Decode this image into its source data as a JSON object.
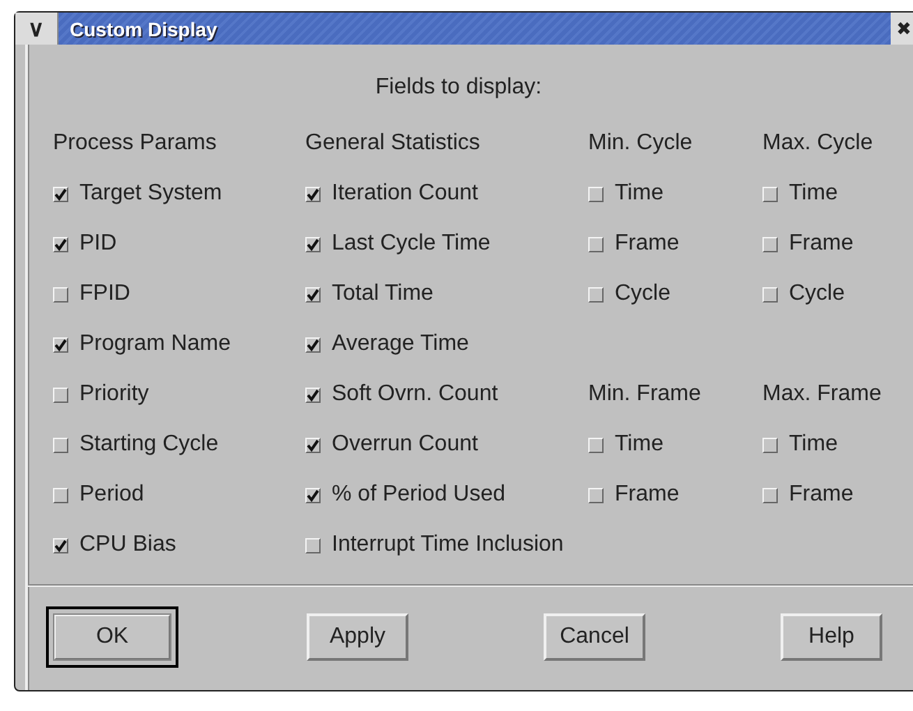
{
  "window": {
    "title": "Custom Display",
    "menu_glyph": "∨",
    "close_glyph": "✖"
  },
  "section_title": "Fields to display:",
  "columns": [
    {
      "cells": [
        {
          "kind": "heading",
          "label": "Process Params"
        },
        {
          "kind": "checkbox",
          "label": "Target System",
          "checked": true
        },
        {
          "kind": "checkbox",
          "label": "PID",
          "checked": true
        },
        {
          "kind": "checkbox",
          "label": "FPID",
          "checked": false
        },
        {
          "kind": "checkbox",
          "label": "Program Name",
          "checked": true
        },
        {
          "kind": "checkbox",
          "label": "Priority",
          "checked": false
        },
        {
          "kind": "checkbox",
          "label": "Starting Cycle",
          "checked": false
        },
        {
          "kind": "checkbox",
          "label": "Period",
          "checked": false
        },
        {
          "kind": "checkbox",
          "label": "CPU Bias",
          "checked": true
        }
      ]
    },
    {
      "cells": [
        {
          "kind": "heading",
          "label": "General Statistics"
        },
        {
          "kind": "checkbox",
          "label": "Iteration Count",
          "checked": true
        },
        {
          "kind": "checkbox",
          "label": "Last Cycle Time",
          "checked": true
        },
        {
          "kind": "checkbox",
          "label": "Total Time",
          "checked": true
        },
        {
          "kind": "checkbox",
          "label": "Average Time",
          "checked": true
        },
        {
          "kind": "checkbox",
          "label": "Soft Ovrn. Count",
          "checked": true
        },
        {
          "kind": "checkbox",
          "label": "Overrun Count",
          "checked": true
        },
        {
          "kind": "checkbox",
          "label": "% of Period Used",
          "checked": true
        },
        {
          "kind": "checkbox",
          "label": "Interrupt Time Inclusion",
          "checked": false
        }
      ]
    },
    {
      "cells": [
        {
          "kind": "heading",
          "label": "Min. Cycle"
        },
        {
          "kind": "checkbox",
          "label": "Time",
          "checked": false
        },
        {
          "kind": "checkbox",
          "label": "Frame",
          "checked": false
        },
        {
          "kind": "checkbox",
          "label": "Cycle",
          "checked": false
        },
        {
          "kind": "empty"
        },
        {
          "kind": "heading",
          "label": "Min. Frame"
        },
        {
          "kind": "checkbox",
          "label": "Time",
          "checked": false
        },
        {
          "kind": "checkbox",
          "label": "Frame",
          "checked": false
        },
        {
          "kind": "empty"
        }
      ]
    },
    {
      "cells": [
        {
          "kind": "heading",
          "label": "Max. Cycle"
        },
        {
          "kind": "checkbox",
          "label": "Time",
          "checked": false
        },
        {
          "kind": "checkbox",
          "label": "Frame",
          "checked": false
        },
        {
          "kind": "checkbox",
          "label": "Cycle",
          "checked": false
        },
        {
          "kind": "empty"
        },
        {
          "kind": "heading",
          "label": "Max. Frame"
        },
        {
          "kind": "checkbox",
          "label": "Time",
          "checked": false
        },
        {
          "kind": "checkbox",
          "label": "Frame",
          "checked": false
        },
        {
          "kind": "empty"
        }
      ]
    }
  ],
  "buttons": [
    {
      "label": "OK",
      "default": true
    },
    {
      "label": "Apply",
      "default": false
    },
    {
      "label": "Cancel",
      "default": false
    },
    {
      "label": "Help",
      "default": false
    }
  ]
}
